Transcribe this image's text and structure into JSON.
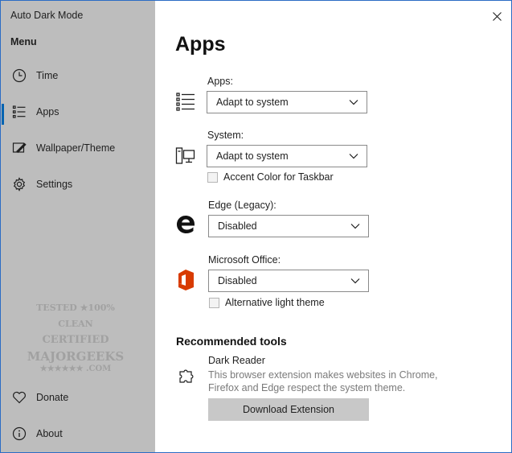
{
  "app": {
    "title": "Auto Dark Mode",
    "menu_label": "Menu"
  },
  "nav": {
    "items": [
      {
        "label": "Time",
        "icon": "clock-icon"
      },
      {
        "label": "Apps",
        "icon": "list-icon",
        "selected": true
      },
      {
        "label": "Wallpaper/Theme",
        "icon": "paint-icon"
      },
      {
        "label": "Settings",
        "icon": "gear-icon"
      }
    ],
    "bottom_items": [
      {
        "label": "Donate",
        "icon": "heart-icon"
      },
      {
        "label": "About",
        "icon": "info-icon"
      }
    ]
  },
  "watermark": {
    "line1": "TESTED ★100% CLEAN",
    "line2": "CERTIFIED",
    "line3": "MAJORGEEKS",
    "line4": "★★★★★★ .COM"
  },
  "page": {
    "title": "Apps"
  },
  "settings": {
    "apps": {
      "label": "Apps:",
      "value": "Adapt to system",
      "icon": "list-icon"
    },
    "system": {
      "label": "System:",
      "value": "Adapt to system",
      "icon": "computer-icon",
      "checkbox_label": "Accent Color for Taskbar"
    },
    "edge": {
      "label": "Edge (Legacy):",
      "value": "Disabled",
      "icon": "edge-icon"
    },
    "office": {
      "label": "Microsoft Office:",
      "value": "Disabled",
      "icon": "office-icon",
      "checkbox_label": "Alternative light theme"
    }
  },
  "recommended": {
    "heading": "Recommended tools",
    "tool_name": "Dark Reader",
    "tool_desc": "This browser extension makes websites in Chrome, Firefox and Edge respect the system theme.",
    "button_label": "Download Extension",
    "icon": "puzzle-icon"
  },
  "colors": {
    "sidebar_bg": "#bdbdbd",
    "accent": "#0063b1",
    "office_orange": "#d83b01"
  }
}
